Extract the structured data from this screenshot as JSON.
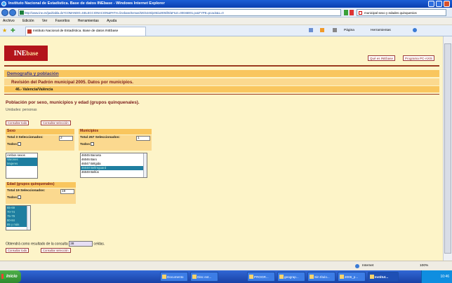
{
  "window": {
    "title": "Instituto Nacional de Estadística. Base de datos INEbase - Windows Internet Explorer"
  },
  "address": {
    "url": "http://www.ine.es/jaxi/tabla.do?COMANDO=SELECCIONACION&PATH=/inebase/temas/t20/e245/p05/a2005/l0/&FILE=00046001.px&TYPE=pcaxis&L=0",
    "search": "municipal sexo y edades quinquenios"
  },
  "menu": [
    "Archivo",
    "Edición",
    "Ver",
    "Favoritos",
    "Herramientas",
    "Ayuda"
  ],
  "tabbar": {
    "tab_title": "Instituto Nacional de Estadística. Base de datos INEbase",
    "pagina": "Página",
    "herramientas": "Herramientas"
  },
  "header": {
    "logo_ine": "INE",
    "logo_base": "base",
    "link_que_es": "Qué es INEbase",
    "link_pcaxis": "Programa PC-AXIS"
  },
  "breadcrumbs": {
    "section": "Demografía y población",
    "table_group": "Revisión del Padrón municipal 2005. Datos por municipios.",
    "province": "46.- Valencia/València"
  },
  "table": {
    "title": "Población por sexo, municipios y edad (grupos quinquenales).",
    "units": "Unidades: personas"
  },
  "buttons": {
    "consultar_todo": "Consultar todo",
    "consultar_seleccion": "Consultar selección"
  },
  "variables": {
    "sexo": {
      "name": "Sexo",
      "total_label": "Total 3 Seleccionados:",
      "selected_count": "2",
      "todos_label": "Todos",
      "options": [
        {
          "label": "Ambos sexos",
          "selected": false
        },
        {
          "label": "Varones",
          "selected": true
        },
        {
          "label": "Mujeres",
          "selected": true
        }
      ]
    },
    "municipios": {
      "name": "Municipios",
      "total_label": "Total 267 Seleccionados:",
      "selected_count": "1",
      "todos_label": "Todos",
      "options": [
        {
          "label": "46045 Barxeta",
          "selected": false
        },
        {
          "label": "46046 Barx",
          "selected": false
        },
        {
          "label": "46047 Bèlgida",
          "selected": false
        },
        {
          "label": "46048 Bellreguard",
          "selected": true
        },
        {
          "label": "46049 Bellús",
          "selected": false
        }
      ]
    },
    "edad": {
      "name": "Edad (grupos quinquenales)",
      "total_label": "Total 19 Seleccionados:",
      "selected_count": "19",
      "todos_label": "Todos",
      "options": [
        {
          "label": "65-69",
          "selected": true
        },
        {
          "label": "70-74",
          "selected": true
        },
        {
          "label": "75-79",
          "selected": true
        },
        {
          "label": "80-84",
          "selected": true
        },
        {
          "label": "85 y más",
          "selected": true
        }
      ]
    }
  },
  "result": {
    "prefix": "Obtendrá como resultado de la consulta",
    "cells": "38",
    "suffix": "celdas."
  },
  "statusbar": {
    "zone": "Internet",
    "zoom": "100%"
  },
  "taskbar": {
    "start": "Inicio",
    "items": [
      "Documento",
      "Disc ext...",
      "PROGR...",
      "geograp...",
      "Sin título...",
      "2006_p...",
      "Institut..."
    ],
    "clock": "10:46"
  },
  "colors": {
    "accent": "#b3141b",
    "band": "#f9c65e",
    "page_bg": "#fdf4c8",
    "selected_option": "#1e7ea0"
  }
}
